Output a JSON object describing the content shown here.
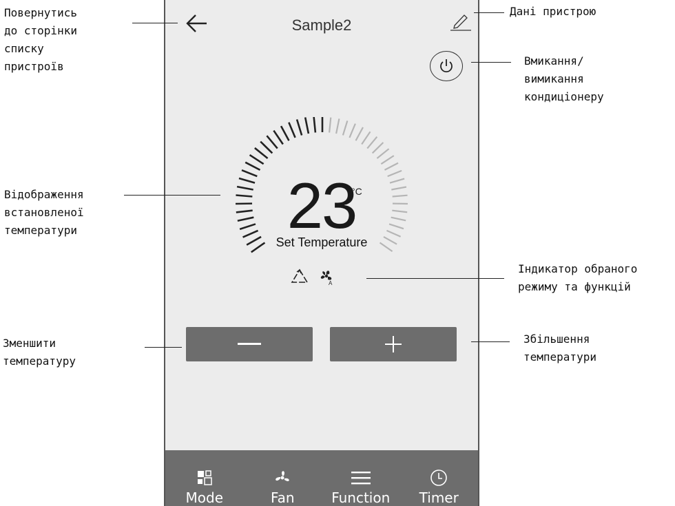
{
  "header": {
    "title": "Sample2"
  },
  "temperature": {
    "value": "23",
    "unit": "°C",
    "caption": "Set Temperature"
  },
  "mode_indicators": [
    "recycle-icon",
    "fan-auto-icon"
  ],
  "controls": {
    "decrease_label": "−",
    "increase_label": "+"
  },
  "bottom_nav": [
    {
      "label": "Mode",
      "icon": "mode-icon"
    },
    {
      "label": "Fan",
      "icon": "fan-icon"
    },
    {
      "label": "Function",
      "icon": "menu-icon"
    },
    {
      "label": "Timer",
      "icon": "clock-icon"
    }
  ],
  "annotations": {
    "back": "Повернутись\nдо сторінки\nсписку\nпристроїв",
    "device_info": "Дані пристрою",
    "power": "Вмикання/\nвимикання\nкондиціонеру",
    "temp_display": "Відображення\nвстановленої\nтемператури",
    "mode_indicator": "Індикатор обраного\nрежиму та функцій",
    "decrease": "Зменшити\nтемпературу",
    "increase": "Збільшення\nтемператури"
  },
  "colors": {
    "screen_bg": "#ececec",
    "button_bg": "#6d6d6d",
    "dial_active": "#222222",
    "dial_inactive": "#b5b5b5"
  }
}
